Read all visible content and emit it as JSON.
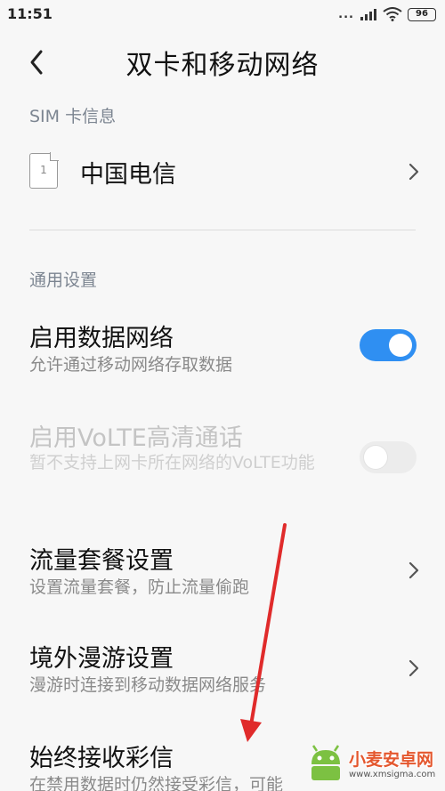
{
  "status_bar": {
    "time": "11:51",
    "signal_dots": "...",
    "battery": "96"
  },
  "header": {
    "title": "双卡和移动网络"
  },
  "sim_section": {
    "header": "SIM 卡信息",
    "sim_slot_number": "1",
    "carrier": "中国电信"
  },
  "general_section": {
    "header": "通用设置",
    "items": [
      {
        "title": "启用数据网络",
        "subtitle": "允许通过移动网络存取数据",
        "control": "toggle",
        "state": "on"
      },
      {
        "title": "启用VoLTE高清通话",
        "subtitle": "暂不支持上网卡所在网络的VoLTE功能",
        "control": "toggle",
        "state": "off",
        "disabled": true
      },
      {
        "title": "流量套餐设置",
        "subtitle": "设置流量套餐，防止流量偷跑",
        "control": "chevron"
      },
      {
        "title": "境外漫游设置",
        "subtitle": "漫游时连接到移动数据网络服务",
        "control": "chevron"
      },
      {
        "title": "始终接收彩信",
        "subtitle": "在禁用数据时仍然接受彩信，可能",
        "control": "toggle"
      }
    ]
  },
  "colors": {
    "accent": "#2f8ff2",
    "annotation_arrow": "#e02b2b",
    "section_header": "#7c8591"
  },
  "watermark": {
    "title": "小麦安卓网",
    "url": "www.xmsigma.com"
  }
}
